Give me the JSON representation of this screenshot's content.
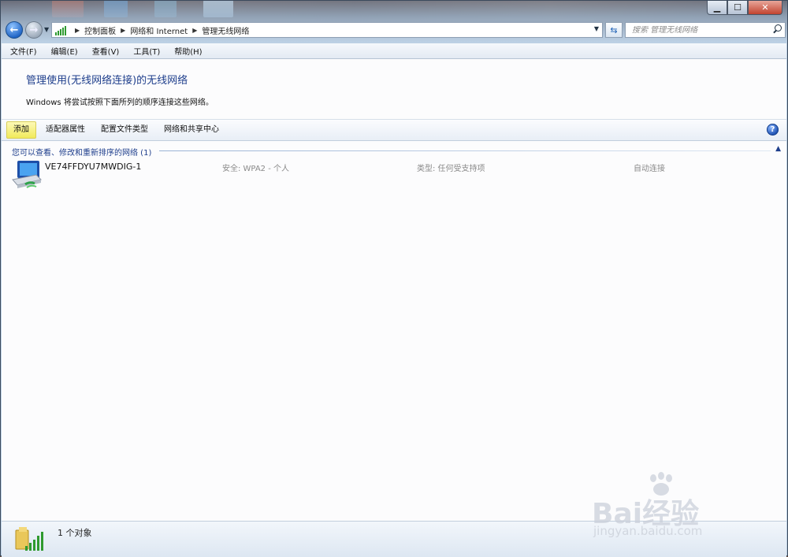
{
  "window": {
    "caption": {
      "minimize": "▁",
      "maximize": "☐",
      "close": "✕"
    }
  },
  "nav": {
    "back": "←",
    "forward": "→"
  },
  "address": {
    "crumbs": [
      "控制面板",
      "网络和 Internet",
      "管理无线网络"
    ]
  },
  "search": {
    "placeholder": "搜索 管理无线网络"
  },
  "menu": {
    "items": [
      "文件(F)",
      "编辑(E)",
      "查看(V)",
      "工具(T)",
      "帮助(H)"
    ]
  },
  "main": {
    "title": "管理使用(无线网络连接)的无线网络",
    "description": "Windows 将尝试按照下面所列的顺序连接这些网络。"
  },
  "commands": {
    "items": [
      "添加",
      "适配器属性",
      "配置文件类型",
      "网络和共享中心"
    ]
  },
  "group": {
    "header": "您可以查看、修改和重新排序的网络 (1)"
  },
  "networks": [
    {
      "name": "VE74FFDYU7MWDIG-1",
      "security": "安全: WPA2 - 个人",
      "type": "类型: 任何受支持项",
      "mode": "自动连接"
    }
  ],
  "status": {
    "count": "1 个对象"
  },
  "watermark": {
    "brand": "Bai经验",
    "sub": "jingyan.baidu.com"
  },
  "colors": {
    "title_blue": "#1e3e8c",
    "highlight": "#f1ea5b"
  }
}
